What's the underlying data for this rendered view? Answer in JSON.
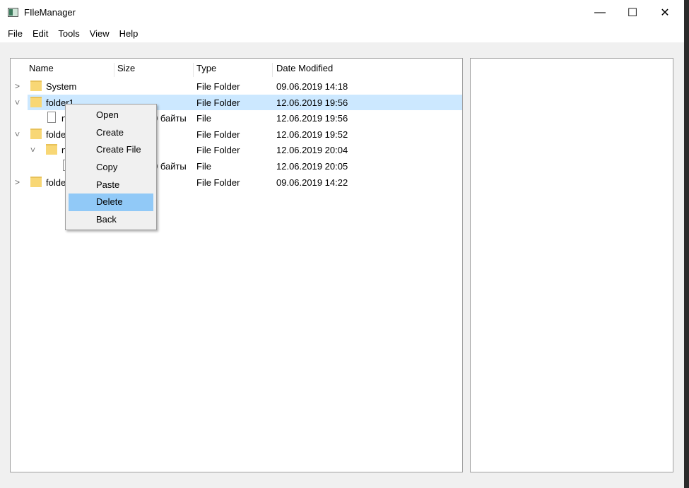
{
  "window": {
    "title": "FIleManager",
    "minimize": "—",
    "maximize": "☐",
    "close": "✕"
  },
  "menu": [
    "File",
    "Edit",
    "Tools",
    "View",
    "Help"
  ],
  "columns": [
    "Name",
    "Size",
    "Type",
    "Date Modified"
  ],
  "rows": [
    {
      "name": "System",
      "size": "",
      "type": "File Folder",
      "date": "09.06.2019 14:18",
      "kind": "folder",
      "expander": "collapsed",
      "level": 0
    },
    {
      "name": "folder1",
      "size": "",
      "type": "File Folder",
      "date": "12.06.2019 19:56",
      "kind": "folder",
      "expander": "expanded",
      "level": 0,
      "selected": true
    },
    {
      "name": "n",
      "size": "0 байты",
      "type": "File",
      "date": "12.06.2019 19:56",
      "kind": "file",
      "level": 1
    },
    {
      "name": "folde",
      "size": "",
      "type": "File Folder",
      "date": "12.06.2019 19:52",
      "kind": "folder",
      "expander": "expanded",
      "level": 0
    },
    {
      "name": "n",
      "size": "",
      "type": "File Folder",
      "date": "12.06.2019 20:04",
      "kind": "folder",
      "expander": "expanded",
      "level": 1
    },
    {
      "name": "",
      "size": "0 байты",
      "type": "File",
      "date": "12.06.2019 20:05",
      "kind": "file",
      "level": 2
    },
    {
      "name": "folde",
      "size": "",
      "type": "File Folder",
      "date": "09.06.2019 14:22",
      "kind": "folder",
      "expander": "collapsed",
      "level": 0
    }
  ],
  "context_menu": {
    "items": [
      "Open",
      "Create",
      "Create File",
      "Copy",
      "Paste",
      "Delete",
      "Back"
    ],
    "highlighted": "Delete"
  }
}
